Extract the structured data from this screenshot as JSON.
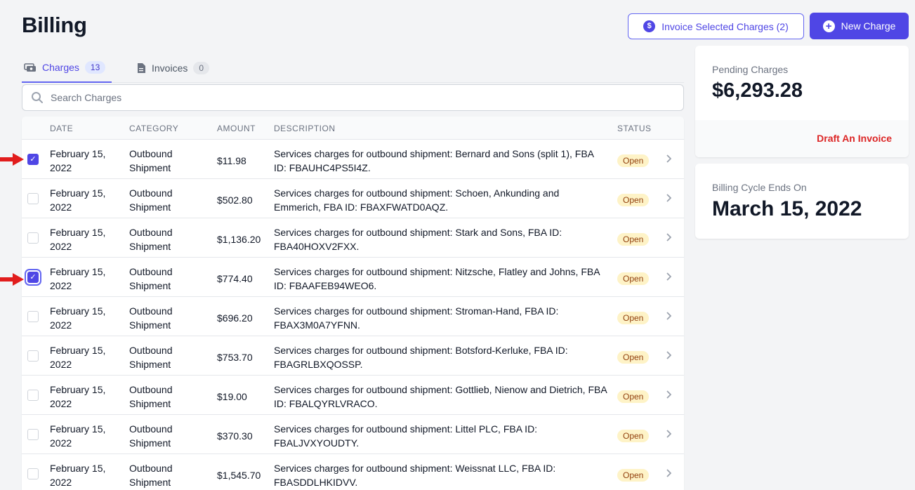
{
  "page": {
    "title": "Billing"
  },
  "actions": {
    "invoice_selected_label": "Invoice Selected Charges (2)",
    "invoice_icon": "dollar-circle-icon",
    "new_charge_label": "New Charge",
    "new_charge_icon": "plus-circle-icon"
  },
  "tabs": [
    {
      "label": "Charges",
      "count": "13",
      "icon": "cash-icon",
      "active": true
    },
    {
      "label": "Invoices",
      "count": "0",
      "icon": "document-icon",
      "active": false
    }
  ],
  "search": {
    "placeholder": "Search Charges",
    "value": ""
  },
  "table": {
    "headers": {
      "date": "DATE",
      "category": "CATEGORY",
      "amount": "AMOUNT",
      "description": "DESCRIPTION",
      "status": "STATUS"
    },
    "rows": [
      {
        "checked": true,
        "focused": false,
        "date": "February 15, 2022",
        "category": "Outbound Shipment",
        "amount": "$11.98",
        "description": "Services charges for outbound shipment: Bernard and Sons (split 1), FBA ID: FBAUHC4PS5I4Z.",
        "status": "Open"
      },
      {
        "checked": false,
        "focused": false,
        "date": "February 15, 2022",
        "category": "Outbound Shipment",
        "amount": "$502.80",
        "description": "Services charges for outbound shipment: Schoen, Ankunding and Emmerich, FBA ID: FBAXFWATD0AQZ.",
        "status": "Open"
      },
      {
        "checked": false,
        "focused": false,
        "date": "February 15, 2022",
        "category": "Outbound Shipment",
        "amount": "$1,136.20",
        "description": "Services charges for outbound shipment: Stark and Sons, FBA ID: FBA40HOXV2FXX.",
        "status": "Open"
      },
      {
        "checked": true,
        "focused": true,
        "date": "February 15, 2022",
        "category": "Outbound Shipment",
        "amount": "$774.40",
        "description": "Services charges for outbound shipment: Nitzsche, Flatley and Johns, FBA ID: FBAAFEB94WEO6.",
        "status": "Open"
      },
      {
        "checked": false,
        "focused": false,
        "date": "February 15, 2022",
        "category": "Outbound Shipment",
        "amount": "$696.20",
        "description": "Services charges for outbound shipment: Stroman-Hand, FBA ID: FBAX3M0A7YFNN.",
        "status": "Open"
      },
      {
        "checked": false,
        "focused": false,
        "date": "February 15, 2022",
        "category": "Outbound Shipment",
        "amount": "$753.70",
        "description": "Services charges for outbound shipment: Botsford-Kerluke, FBA ID: FBAGRLBXQOSSP.",
        "status": "Open"
      },
      {
        "checked": false,
        "focused": false,
        "date": "February 15, 2022",
        "category": "Outbound Shipment",
        "amount": "$19.00",
        "description": "Services charges for outbound shipment: Gottlieb, Nienow and Dietrich, FBA ID: FBALQYRLVRACO.",
        "status": "Open"
      },
      {
        "checked": false,
        "focused": false,
        "date": "February 15, 2022",
        "category": "Outbound Shipment",
        "amount": "$370.30",
        "description": "Services charges for outbound shipment: Littel PLC, FBA ID: FBALJVXYOUDTY.",
        "status": "Open"
      },
      {
        "checked": false,
        "focused": false,
        "date": "February 15, 2022",
        "category": "Outbound Shipment",
        "amount": "$1,545.70",
        "description": "Services charges for outbound shipment: Weissnat LLC, FBA ID: FBASDDLHKIDVV.",
        "status": "Open"
      }
    ]
  },
  "pending_card": {
    "label": "Pending Charges",
    "value": "$6,293.28",
    "link": "Draft An Invoice"
  },
  "cycle_card": {
    "label": "Billing Cycle Ends On",
    "value": "March 15, 2022"
  },
  "colors": {
    "accent": "#4f46e5",
    "danger": "#dc2626",
    "badge_bg": "#fef3c7",
    "badge_text": "#92400e",
    "annotation_arrow": "#e11d1d"
  }
}
